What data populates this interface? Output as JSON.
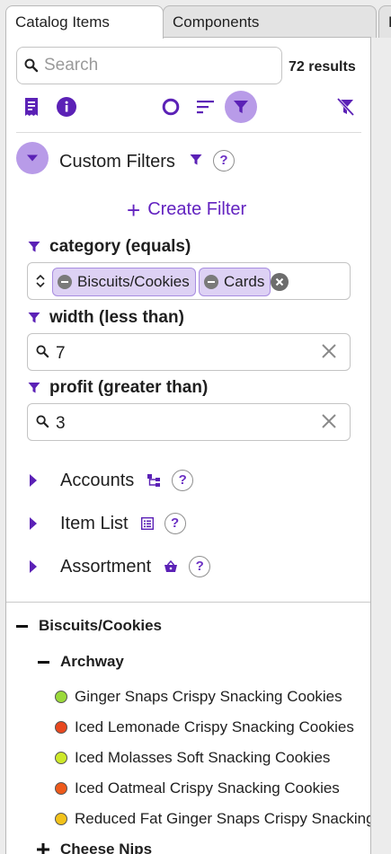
{
  "tabs": [
    {
      "label": "Catalog Items"
    },
    {
      "label": "Components"
    },
    {
      "label": "P"
    }
  ],
  "search": {
    "placeholder": "Search",
    "value": ""
  },
  "results_text": "72 results",
  "toolbar": {
    "icons": [
      "receipt-icon",
      "info-icon",
      "circle-icon",
      "sort-icon",
      "filter-icon",
      "clear-filter-icon"
    ],
    "accent": "#6323c0",
    "active_bg": "#b89be8"
  },
  "custom_filters": {
    "title": "Custom Filters",
    "help": "?",
    "create_label": "Create Filter",
    "filters": [
      {
        "label": "category (equals)",
        "chips": [
          "Biscuits/Cookies",
          "Cards"
        ]
      },
      {
        "label": "width (less than)",
        "value": "7"
      },
      {
        "label": "profit (greater than)",
        "value": "3"
      }
    ]
  },
  "sections": [
    {
      "label": "Accounts",
      "icon": "hierarchy-icon",
      "help": "?"
    },
    {
      "label": "Item List",
      "icon": "list-icon",
      "help": "?"
    },
    {
      "label": "Assortment",
      "icon": "basket-icon",
      "help": "?"
    }
  ],
  "tree": {
    "group": "Biscuits/Cookies",
    "subgroup": "Archway",
    "items": [
      {
        "label": "Ginger Snaps Crispy Snacking Cookies",
        "color": "#9ad93a"
      },
      {
        "label": "Iced Lemonade Crispy Snacking Cookies",
        "color": "#e8481f"
      },
      {
        "label": "Iced Molasses Soft Snacking Cookies",
        "color": "#cde82a"
      },
      {
        "label": "Iced Oatmeal Crispy Snacking Cookies",
        "color": "#ee5a1b"
      },
      {
        "label": "Reduced Fat Ginger Snaps Crispy Snacking Cookies",
        "color": "#f2c21b"
      }
    ],
    "next_group": "Cheese Nips"
  }
}
